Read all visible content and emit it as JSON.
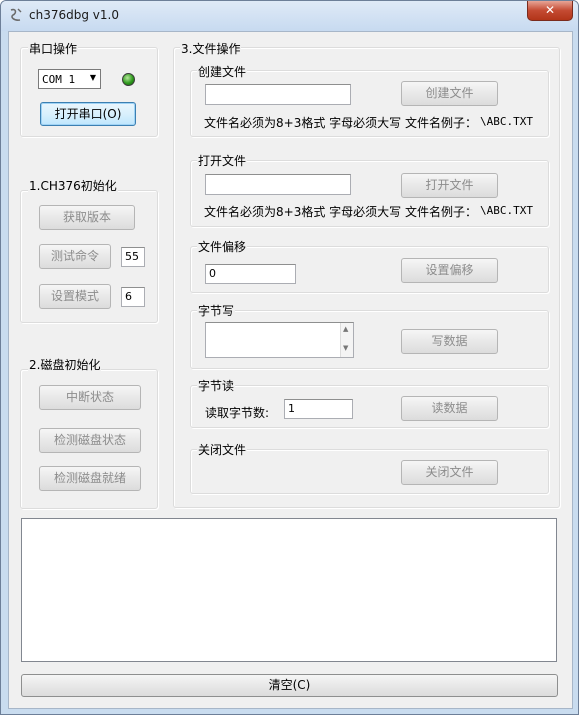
{
  "window": {
    "title": "ch376dbg v1.0",
    "close_label": "✕"
  },
  "serial": {
    "group_label": "串口操作",
    "port_selected": "COM 1",
    "open_button": "打开串口(O)",
    "led_color": "#2f9a1e"
  },
  "init376": {
    "group_label": "1.CH376初始化",
    "get_version": "获取版本",
    "test_command": "测试命令",
    "test_value": "55",
    "set_mode": "设置模式",
    "mode_value": "6"
  },
  "disk": {
    "group_label": "2.磁盘初始化",
    "interrupt_status": "中断状态",
    "check_disk_status": "检测磁盘状态",
    "check_disk_ready": "检测磁盘就绪"
  },
  "file_ops": {
    "group_label": "3.文件操作",
    "create": {
      "label": "创建文件",
      "value": "",
      "button": "创建文件",
      "hint": "文件名必须为8+3格式 字母必须大写 文件名例子：",
      "example": "\\ABC.TXT"
    },
    "open": {
      "label": "打开文件",
      "value": "",
      "button": "打开文件",
      "hint": "文件名必须为8+3格式 字母必须大写 文件名例子：",
      "example": "\\ABC.TXT"
    },
    "offset": {
      "label": "文件偏移",
      "value": "0",
      "button": "设置偏移"
    },
    "write": {
      "label": "字节写",
      "value": "",
      "button": "写数据"
    },
    "read": {
      "label": "字节读",
      "count_label": "读取字节数:",
      "count_value": "1",
      "button": "读数据"
    },
    "close": {
      "label": "关闭文件",
      "button": "关闭文件"
    }
  },
  "log": {
    "content": ""
  },
  "clear_button": "清空(C)"
}
